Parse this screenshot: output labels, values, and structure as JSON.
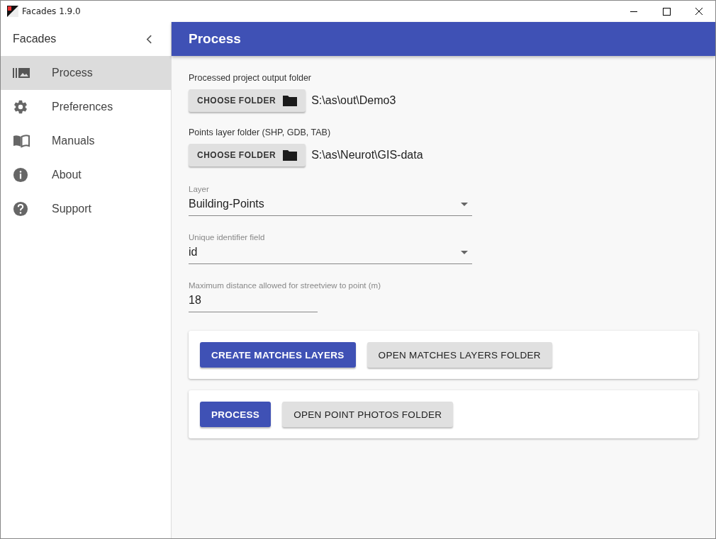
{
  "window": {
    "title": "Facades 1.9.0"
  },
  "sidebar": {
    "title": "Facades",
    "items": [
      {
        "label": "Process",
        "kind": "photos",
        "selected": true
      },
      {
        "label": "Preferences",
        "kind": "gear",
        "selected": false
      },
      {
        "label": "Manuals",
        "kind": "book",
        "selected": false
      },
      {
        "label": "About",
        "kind": "info",
        "selected": false
      },
      {
        "label": "Support",
        "kind": "help",
        "selected": false
      }
    ]
  },
  "header": {
    "title": "Process"
  },
  "folders": [
    {
      "label": "Processed project output folder",
      "button": "CHOOSE FOLDER",
      "path": "S:\\as\\out\\Demo3"
    },
    {
      "label": "Points layer folder (SHP, GDB, TAB)",
      "button": "CHOOSE FOLDER",
      "path": "S:\\as\\Neurot\\GIS-data"
    }
  ],
  "fields": [
    {
      "kind": "select",
      "label": "Layer",
      "value": "Building-Points"
    },
    {
      "kind": "select",
      "label": "Unique identifier field",
      "value": "id"
    },
    {
      "kind": "text",
      "label": "Maximum distance allowed for streetview to point (m)",
      "value": "18"
    }
  ],
  "cards": [
    {
      "buttons": [
        {
          "kind": "primary",
          "label": "CREATE MATCHES LAYERS"
        },
        {
          "kind": "secondary",
          "label": "OPEN MATCHES LAYERS FOLDER"
        }
      ]
    },
    {
      "buttons": [
        {
          "kind": "primary",
          "label": "PROCESS"
        },
        {
          "kind": "secondary",
          "label": "OPEN POINT PHOTOS FOLDER"
        }
      ]
    }
  ]
}
